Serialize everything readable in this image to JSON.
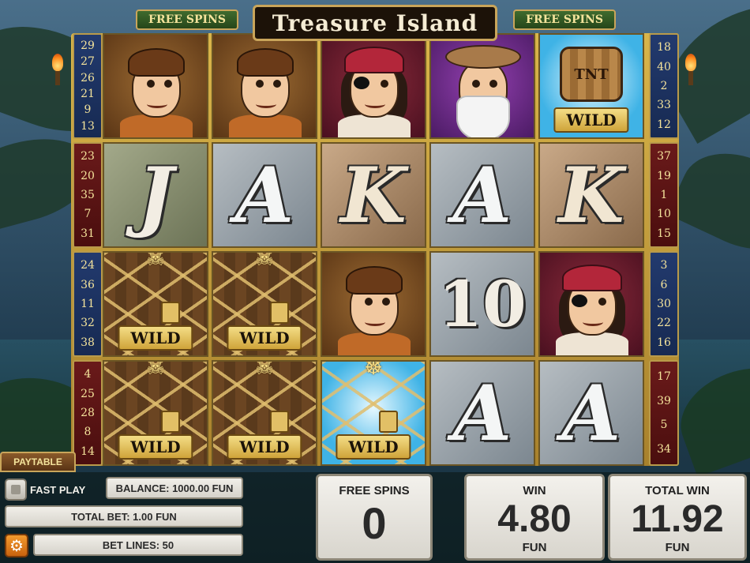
{
  "header": {
    "title": "Treasure Island",
    "free_spins_left": "FREE SPINS",
    "free_spins_right": "FREE SPINS"
  },
  "reels": [
    [
      {
        "symbol": "boy-face",
        "bg": "bg-brown"
      },
      {
        "symbol": "J",
        "bg": "bg-map-green"
      },
      {
        "symbol": "chained-wild",
        "bg": "bg-wood",
        "tag": "WILD"
      },
      {
        "symbol": "chained-wild",
        "bg": "bg-wood",
        "tag": "WILD"
      }
    ],
    [
      {
        "symbol": "boy-face",
        "bg": "bg-brown"
      },
      {
        "symbol": "A",
        "bg": "bg-map-gray"
      },
      {
        "symbol": "chained-wild",
        "bg": "bg-wood",
        "tag": "WILD"
      },
      {
        "symbol": "chained-wild",
        "bg": "bg-wood",
        "tag": "WILD"
      }
    ],
    [
      {
        "symbol": "pirate-woman",
        "bg": "bg-red"
      },
      {
        "symbol": "K",
        "bg": "bg-map-tan"
      },
      {
        "symbol": "boy-face",
        "bg": "bg-brown"
      },
      {
        "symbol": "chained-wild-ship",
        "bg": "bg-cyan",
        "tag": "WILD"
      }
    ],
    [
      {
        "symbol": "old-man",
        "bg": "bg-purple"
      },
      {
        "symbol": "A",
        "bg": "bg-map-gray"
      },
      {
        "symbol": "10",
        "bg": "bg-map-gray"
      },
      {
        "symbol": "A",
        "bg": "bg-map-gray"
      }
    ],
    [
      {
        "symbol": "tnt-barrel-wild",
        "bg": "bg-cyan",
        "tag": "WILD",
        "barrel": "TNT"
      },
      {
        "symbol": "K",
        "bg": "bg-map-tan"
      },
      {
        "symbol": "pirate-woman",
        "bg": "bg-red"
      },
      {
        "symbol": "A",
        "bg": "bg-map-gray"
      }
    ]
  ],
  "left_lines": [
    {
      "color": "blue",
      "numbers": [
        "29",
        "27",
        "26",
        "21",
        "9",
        "13"
      ]
    },
    {
      "color": "red",
      "numbers": [
        "23",
        "20",
        "35",
        "7",
        "31"
      ]
    },
    {
      "color": "blue",
      "numbers": [
        "24",
        "36",
        "11",
        "32",
        "38"
      ]
    },
    {
      "color": "red",
      "numbers": [
        "4",
        "25",
        "28",
        "8",
        "14"
      ]
    }
  ],
  "right_lines": [
    {
      "color": "blue",
      "numbers": [
        "18",
        "40",
        "2",
        "33",
        "12"
      ]
    },
    {
      "color": "red",
      "numbers": [
        "37",
        "19",
        "1",
        "10",
        "15"
      ]
    },
    {
      "color": "blue",
      "numbers": [
        "3",
        "6",
        "30",
        "22",
        "16"
      ]
    },
    {
      "color": "red",
      "numbers": [
        "17",
        "39",
        "5",
        "34"
      ]
    }
  ],
  "controls": {
    "paytable": "PAYTABLE",
    "fast_play": "FAST PLAY",
    "balance": "BALANCE: 1000.00 FUN",
    "total_bet": "TOTAL BET: 1.00 FUN",
    "bet_lines": "BET LINES: 50",
    "free_spins_label": "FREE SPINS",
    "free_spins_value": "0",
    "win_label": "WIN",
    "win_value": "4.80",
    "win_unit": "FUN",
    "total_win_label": "TOTAL WIN",
    "total_win_value": "11.92",
    "total_win_unit": "FUN"
  },
  "colors": {
    "gold": "#c9a55a",
    "line_blue": "#223a6e",
    "line_red": "#6a1a1a",
    "gear_orange": "#f39a2e"
  }
}
